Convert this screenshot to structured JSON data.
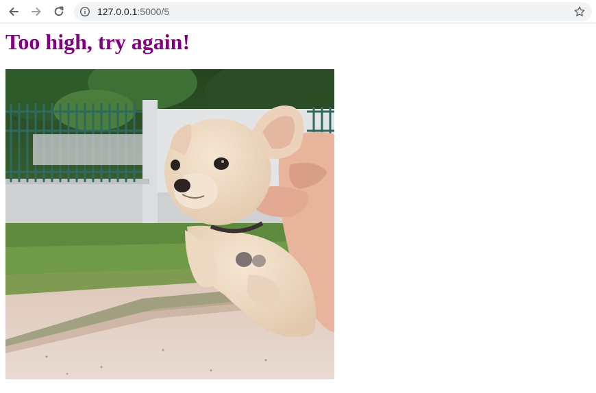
{
  "browser": {
    "url_host": "127.0.0.1",
    "url_path": ":5000/5",
    "icons": {
      "back": "arrow-left-icon",
      "forward": "arrow-right-icon",
      "reload": "reload-icon",
      "info": "info-icon",
      "bookmark": "star-icon"
    }
  },
  "page": {
    "title": "Too high, try again!",
    "title_color": "#800080"
  },
  "image": {
    "subject": "puppy-gif"
  }
}
